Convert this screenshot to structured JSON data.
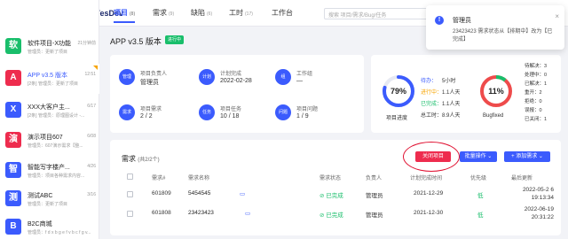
{
  "colors": {
    "brand": "#3b5bfd",
    "success": "#19be6b",
    "danger": "#ee2c4e",
    "progress_ring": "#3b5bfd",
    "bug_ring": "#ee4b4b"
  },
  "topbar": {
    "logo": "YesDev",
    "nav": [
      {
        "label": "项目",
        "count": "(8)"
      },
      {
        "label": "需求",
        "count": "(9)"
      },
      {
        "label": "缺陷",
        "count": "(6)"
      },
      {
        "label": "工时",
        "count": "(17)"
      },
      {
        "label": "工作台",
        "count": ""
      }
    ],
    "search_placeholder": "搜索 项目/需求/Bug/任务"
  },
  "sidebar": {
    "items": [
      {
        "icon": "软",
        "color": "#19be6b",
        "title": "软件项目-X功能",
        "sub": "管理员：更新了项目",
        "time": "21分钟前",
        "flag": false,
        "blue": false
      },
      {
        "icon": "A",
        "color": "#ee2c4e",
        "title": "APP v3.5 版本",
        "sub": "[2条] 管理员：更新了项目",
        "time": "12:51",
        "flag": true,
        "blue": true
      },
      {
        "icon": "X",
        "color": "#3b5bfd",
        "title": "XXX大客户主...",
        "sub": "[2条] 管理员：原理图设计 -...",
        "time": "6/17",
        "flag": false,
        "blue": false
      },
      {
        "icon": "演",
        "color": "#ee2c4e",
        "title": "演示项目607",
        "sub": "管理员：607演示需求【整...",
        "time": "6/08",
        "flag": false,
        "blue": false
      },
      {
        "icon": "智",
        "color": "#3b5bfd",
        "title": "智能写字楼产...",
        "sub": "管理员：项目各种需求内容...",
        "time": "4/26",
        "flag": false,
        "blue": false
      },
      {
        "icon": "测",
        "color": "#3b5bfd",
        "title": "测试ABC",
        "sub": "管理员：更新了项目",
        "time": "3/16",
        "flag": false,
        "blue": false
      },
      {
        "icon": "B",
        "color": "#3b5bfd",
        "title": "B2C商城",
        "sub": "管理员：f d x b g e f v b c f g v...",
        "time": "",
        "flag": false,
        "blue": false
      }
    ]
  },
  "project": {
    "title": "APP v3.5 版本",
    "badge": "进行中",
    "info": [
      {
        "icon": "管理",
        "label": "项目负责人",
        "value": "管理员"
      },
      {
        "icon": "计划",
        "label": "计划完成",
        "value": "2022-02-28"
      },
      {
        "icon": "组",
        "label": "工作组",
        "value": "—"
      },
      {
        "icon": "需求",
        "label": "项目需求",
        "value": "2 / 2"
      },
      {
        "icon": "任务",
        "label": "项目任务",
        "value": "10 / 18"
      },
      {
        "icon": "问题",
        "label": "项目问题",
        "value": "1 / 9"
      }
    ],
    "progress": {
      "percent_text": "79%",
      "value": 0.79,
      "label": "项目进度"
    },
    "stats": [
      {
        "key": "待办：",
        "value": "5小时",
        "color": "#3b5bfd"
      },
      {
        "key": "进行中：",
        "value": "1.1人天",
        "color": "#f7a400"
      },
      {
        "key": "已完成：",
        "value": "1.1人天",
        "color": "#19be6b"
      },
      {
        "key": "总工时：",
        "value": "8.9人天",
        "color": "#333333"
      }
    ],
    "bug": {
      "percent_text": "11%",
      "value": 0.11,
      "label": "Bugfixed"
    },
    "bug_stats": [
      {
        "key": "待解决：",
        "value": "3"
      },
      {
        "key": "处理中：",
        "value": "0"
      },
      {
        "key": "已解决：",
        "value": "1"
      },
      {
        "key": "重开：",
        "value": "2"
      },
      {
        "key": "拒绝：",
        "value": "0"
      },
      {
        "key": "误报：",
        "value": "0"
      },
      {
        "key": "已关闭：",
        "value": "1"
      }
    ]
  },
  "requirements": {
    "title": "需求",
    "count": "(共2/2个)",
    "buttons": {
      "close": "关闭项目",
      "batch": "批量操作 ⌄",
      "add": "+ 添加需求 ⌄"
    },
    "columns": [
      "需求#",
      "需求名称",
      "需求状态",
      "负责人",
      "计划完成时间",
      "优先级",
      "最后更新"
    ],
    "rows": [
      {
        "id": "601809",
        "name": "5454545",
        "status": "已完成",
        "owner": "管理员",
        "due": "2021-12-29",
        "priority": "低",
        "updated": "2022-05-2 6 19:13:34"
      },
      {
        "id": "601808",
        "name": "23423423",
        "status": "已完成",
        "owner": "管理员",
        "due": "2021-12-30",
        "priority": "低",
        "updated": "2022-06-19 20:31:22"
      }
    ]
  },
  "toast": {
    "title": "管理员",
    "message": "23423423 需求状态从【排期中】改为【已完成】",
    "close": "×"
  }
}
